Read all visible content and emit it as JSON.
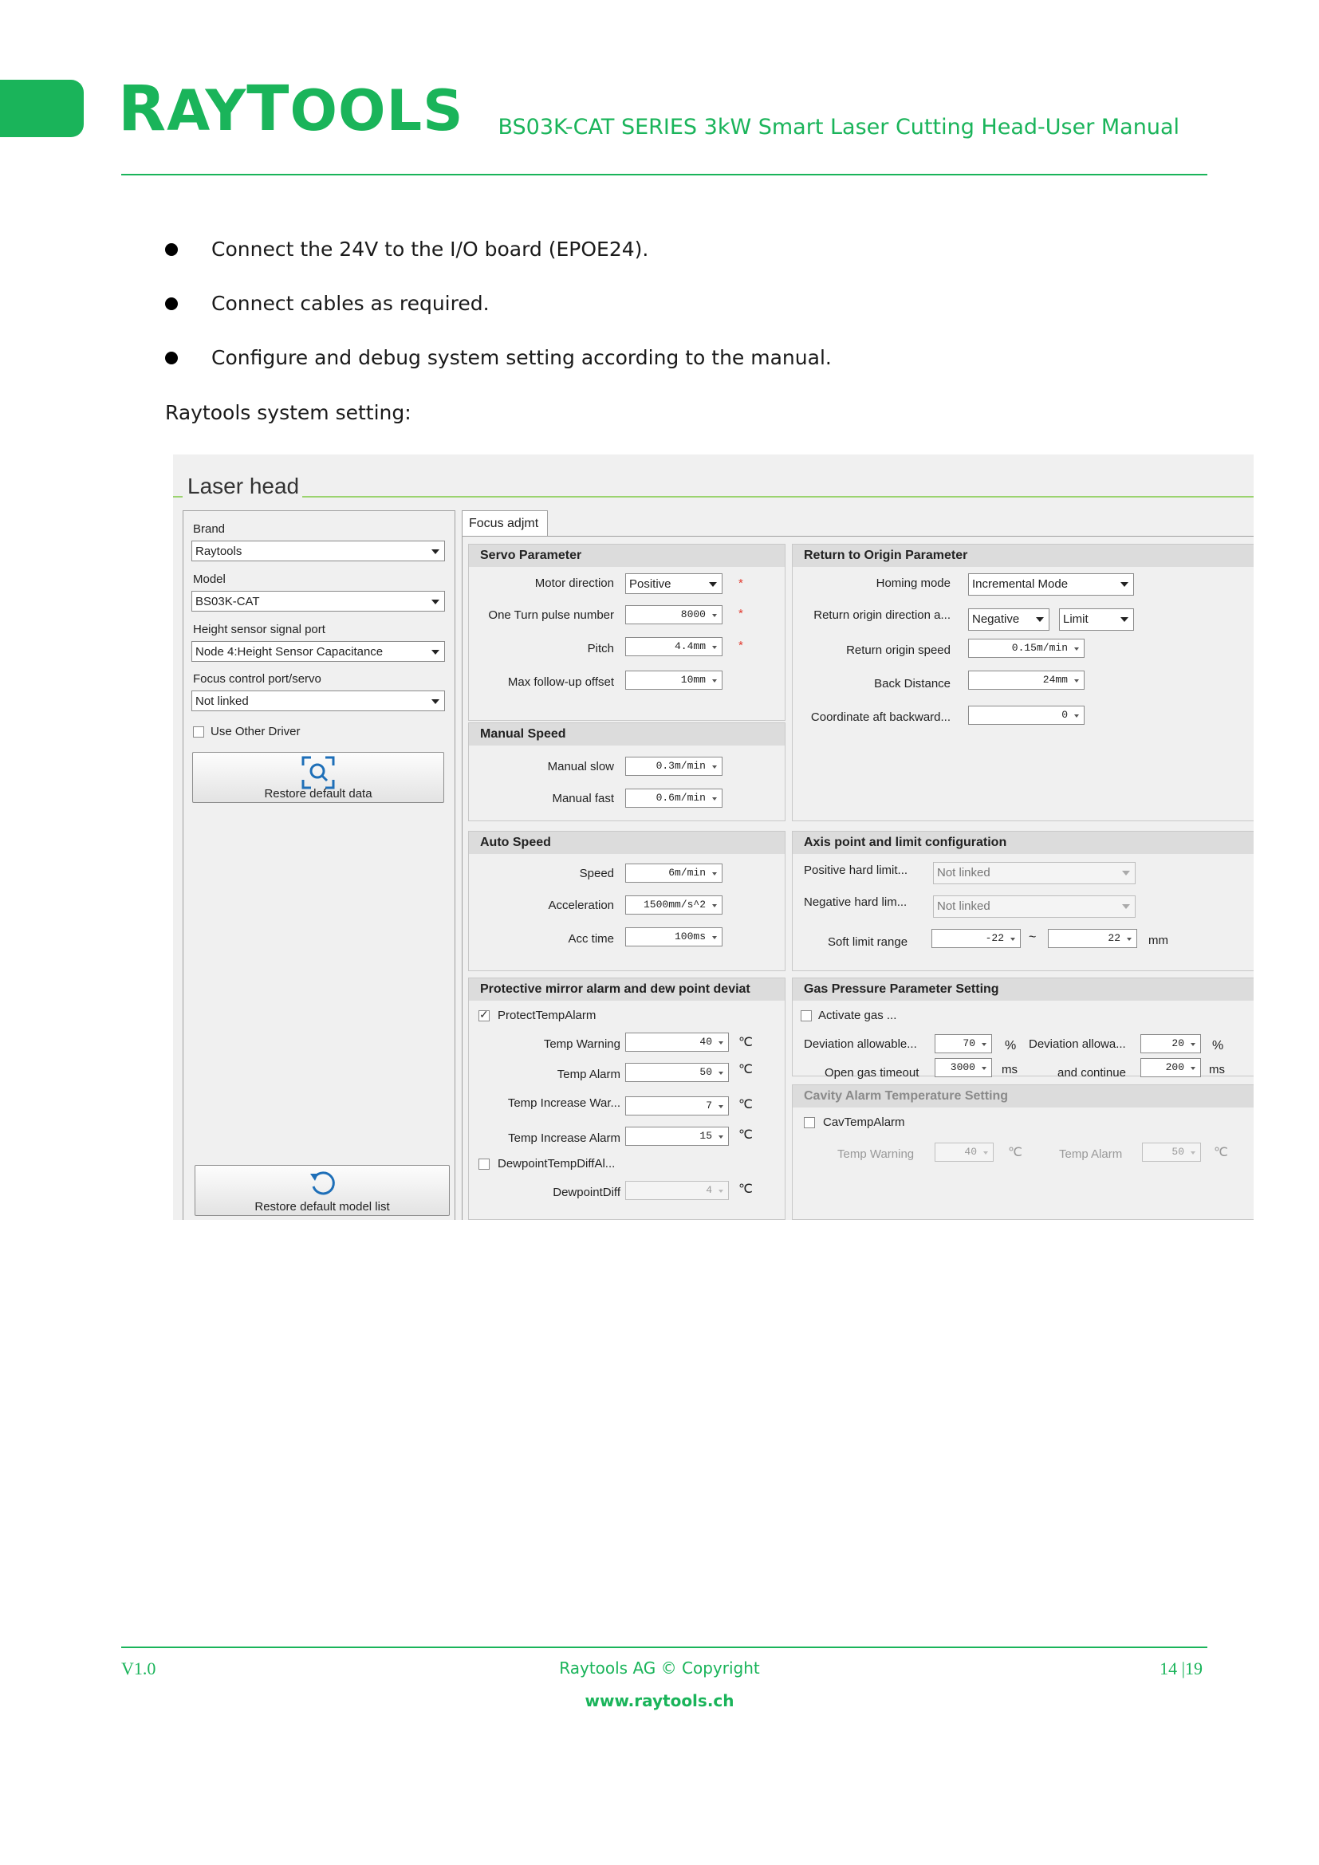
{
  "header": {
    "logo_first": "R",
    "logo_mid": "AY",
    "logo_second": "T",
    "logo_rest": "OOLS",
    "doc_title": "BS03K-CAT SERIES 3kW Smart Laser Cutting Head-User Manual",
    "accent_color": "#1ab45a"
  },
  "body": {
    "bullets": [
      "Connect the 24V to the I/O board (EPOE24).",
      "Connect cables as required.",
      "Configure and debug system setting according to the manual."
    ],
    "paragraph": "Raytools system setting:"
  },
  "screenshot": {
    "title": "Laser head",
    "left": {
      "brand_label": "Brand",
      "brand_value": "Raytools",
      "model_label": "Model",
      "model_value": "BS03K-CAT",
      "height_port_label": "Height sensor signal port",
      "height_port_value": "Node 4:Height Sensor Capacitance",
      "focus_port_label": "Focus control port/servo",
      "focus_port_value": "Not linked",
      "use_other_driver": "Use Other Driver",
      "restore_default_data": "Restore default data",
      "restore_default_model_list": "Restore default model list",
      "search_icon": "search-icon",
      "refresh_icon": "refresh-icon"
    },
    "tab": "Focus adjmt",
    "servo": {
      "header": "Servo Parameter",
      "motor_direction_label": "Motor direction",
      "motor_direction_value": "Positive",
      "pulse_label": "One Turn pulse number",
      "pulse_value": "8000",
      "pitch_label": "Pitch",
      "pitch_value": "4.4mm",
      "followup_label": "Max follow-up offset",
      "followup_value": "10mm",
      "required_mark": "*"
    },
    "manual_speed": {
      "header": "Manual Speed",
      "slow_label": "Manual slow",
      "slow_value": "0.3m/min",
      "fast_label": "Manual fast",
      "fast_value": "0.6m/min"
    },
    "auto_speed": {
      "header": "Auto Speed",
      "speed_label": "Speed",
      "speed_value": "6m/min",
      "accel_label": "Acceleration",
      "accel_value": "1500mm/s^2",
      "acctime_label": "Acc time",
      "acctime_value": "100ms"
    },
    "protective": {
      "header": "Protective mirror alarm and dew point deviat",
      "protect_temp_alarm": "ProtectTempAlarm",
      "temp_warning_label": "Temp Warning",
      "temp_warning_value": "40",
      "temp_alarm_label": "Temp Alarm",
      "temp_alarm_value": "50",
      "temp_inc_war_label": "Temp Increase War...",
      "temp_inc_war_value": "7",
      "temp_inc_alarm_label": "Temp Increase Alarm",
      "temp_inc_alarm_value": "15",
      "dewpoint_chk": "DewpointTempDiffAl...",
      "dewpoint_label": "DewpointDiff",
      "dewpoint_value": "4",
      "unit_c": "℃"
    },
    "origin": {
      "header": "Return to Origin Parameter",
      "homing_label": "Homing mode",
      "homing_value": "Incremental Mode",
      "direction_label": "Return origin direction a...",
      "direction_value": "Negative",
      "direction_value2": "Limit",
      "speed_label": "Return origin speed",
      "speed_value": "0.15m/min",
      "back_label": "Back Distance",
      "back_value": "24mm",
      "coord_label": "Coordinate aft backward...",
      "coord_value": "0"
    },
    "axis": {
      "header": "Axis point and limit configuration",
      "pos_label": "Positive hard limit...",
      "pos_value": "Not linked",
      "neg_label": "Negative hard lim...",
      "neg_value": "Not linked",
      "soft_label": "Soft limit range",
      "soft_min": "-22",
      "soft_max": "22",
      "tilde": "~",
      "unit": "mm"
    },
    "gas": {
      "header": "Gas Pressure Parameter Setting",
      "activate": "Activate gas ...",
      "dev_label": "Deviation allowable...",
      "dev_value": "70",
      "dev_unit": "%",
      "dev2_label": "Deviation allowa...",
      "dev2_value": "20",
      "dev2_unit": "%",
      "timeout_label": "Open gas timeout",
      "timeout_value": "3000",
      "timeout_unit": "ms",
      "continue_label": "and continue",
      "continue_value": "200",
      "continue_unit": "ms"
    },
    "cavity": {
      "header": "Cavity Alarm Temperature Setting",
      "cav_chk": "CavTempAlarm",
      "warn_label": "Temp Warning",
      "warn_value": "40",
      "alarm_label": "Temp Alarm",
      "alarm_value": "50",
      "unit_c": "℃"
    }
  },
  "footer": {
    "version": "V1.0",
    "copyright": "Raytools AG © Copyright",
    "website": "www.raytools.ch",
    "page": "14 |19"
  }
}
